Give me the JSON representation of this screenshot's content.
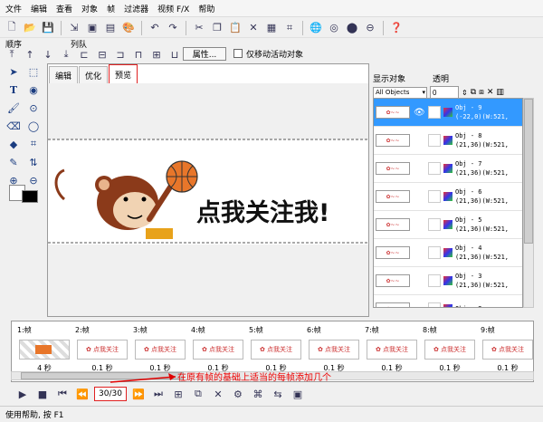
{
  "menu": [
    "文件",
    "编辑",
    "查看",
    "对象",
    "帧",
    "过滤器",
    "视频 F/X",
    "帮助"
  ],
  "toolbar2": {
    "order_label": "顺序",
    "queue_label": "列队",
    "properties_button": "属性...",
    "move_active_only": "仅移动活动对象"
  },
  "tabs": [
    "编辑",
    "优化",
    "预览"
  ],
  "active_tab": "预览",
  "preview_text": "点我关注我!",
  "object_panel": {
    "display_label": "显示对象",
    "display_value": "All Objects",
    "transparent_label": "透明",
    "transparent_value": "0"
  },
  "objects": [
    {
      "name": "Obj - 9",
      "info": "(-22,0)(W:521,",
      "selected": true
    },
    {
      "name": "Obj - 8",
      "info": "(21,36)(W:521,",
      "selected": false
    },
    {
      "name": "Obj - 7",
      "info": "(21,36)(W:521,",
      "selected": false
    },
    {
      "name": "Obj - 6",
      "info": "(21,36)(W:521,",
      "selected": false
    },
    {
      "name": "Obj - 5",
      "info": "(21,36)(W:521,",
      "selected": false
    },
    {
      "name": "Obj - 4",
      "info": "(21,36)(W:521,",
      "selected": false
    },
    {
      "name": "Obj - 3",
      "info": "(21,36)(W:521,",
      "selected": false
    },
    {
      "name": "Obj - 2",
      "info": "",
      "selected": false
    }
  ],
  "frames": [
    {
      "label": "1:帧",
      "time": "4 秒"
    },
    {
      "label": "2:帧",
      "time": "0.1 秒"
    },
    {
      "label": "3:帧",
      "time": "0.1 秒"
    },
    {
      "label": "4:帧",
      "time": "0.1 秒"
    },
    {
      "label": "5:帧",
      "time": "0.1 秒"
    },
    {
      "label": "6:帧",
      "time": "0.1 秒"
    },
    {
      "label": "7:帧",
      "time": "0.1 秒"
    },
    {
      "label": "8:帧",
      "time": "0.1 秒"
    },
    {
      "label": "9:帧",
      "time": "0.1 秒"
    }
  ],
  "frame_counter": "30/30",
  "annotation": "在原有帧的基础上适当的每帧添加几个",
  "status": "使用帮助, 按 F1",
  "colors": {
    "selection": "#3399ff",
    "annotation": "#e00000",
    "monkey": "#8b3a1a",
    "ball": "#e8762a"
  }
}
